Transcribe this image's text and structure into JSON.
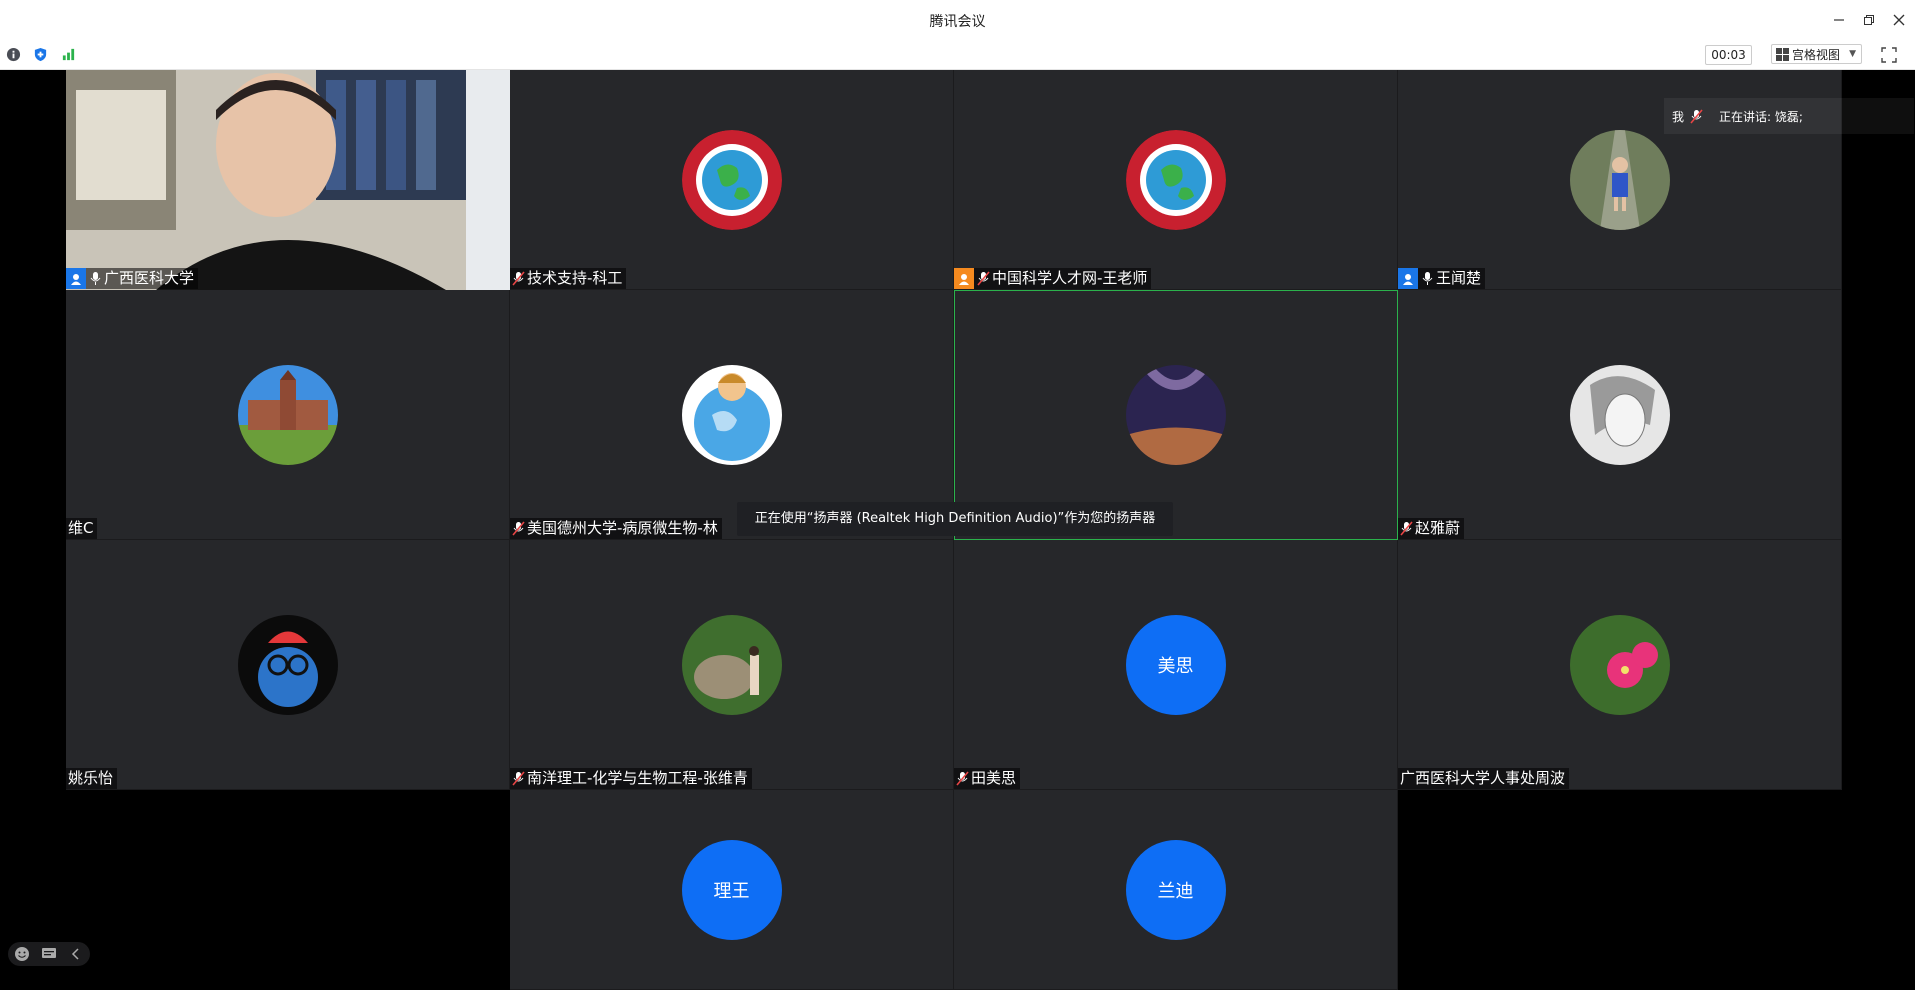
{
  "window": {
    "title": "腾讯会议"
  },
  "toolbar": {
    "icons": [
      "info-icon",
      "shield-icon",
      "signal-icon"
    ],
    "timer": "00:03",
    "view_label": "宫格视图"
  },
  "speaking_panel": {
    "me_label": "我",
    "speaking_label": "正在讲话: 饶磊;"
  },
  "toast": {
    "text": "正在使用“扬声器 (Realtek High Definition Audio)”作为您的扬声器"
  },
  "participants": [
    {
      "name": "广西医科大学",
      "role": "host",
      "mic": "on",
      "avatar": "video"
    },
    {
      "name": "技术支持-科工",
      "role": "none",
      "mic": "muted",
      "avatar": "logo"
    },
    {
      "name": "中国科学人才网-王老师",
      "role": "cohost",
      "mic": "muted",
      "avatar": "logo"
    },
    {
      "name": "王闻楚",
      "role": "host",
      "mic": "on",
      "avatar": "photo-child"
    },
    {
      "name": "维C",
      "role": "none",
      "mic": "none",
      "avatar": "photo-building"
    },
    {
      "name": "美国德州大学-病原微生物-林",
      "role": "none",
      "mic": "muted",
      "avatar": "cartoon-globe"
    },
    {
      "name": "",
      "role": "none",
      "mic": "none",
      "avatar": "photo-desert"
    },
    {
      "name": "赵雅蔚",
      "role": "none",
      "mic": "muted",
      "avatar": "sketch-face"
    },
    {
      "name": "姚乐怡",
      "role": "none",
      "mic": "none",
      "avatar": "toy-figure"
    },
    {
      "name": "南洋理工-化学与生物工程-张维青",
      "role": "none",
      "mic": "muted",
      "avatar": "photo-rock"
    },
    {
      "name": "田美思",
      "role": "none",
      "mic": "muted",
      "avatar": "text",
      "avatar_text": "美思"
    },
    {
      "name": "广西医科大学人事处周波",
      "role": "none",
      "mic": "none",
      "avatar": "photo-flower"
    },
    {
      "name": "",
      "role": "none",
      "mic": "none",
      "avatar": "text",
      "avatar_text": "理王"
    },
    {
      "name": "",
      "role": "none",
      "mic": "none",
      "avatar": "text",
      "avatar_text": "兰迪"
    }
  ],
  "colors": {
    "tile_bg": "#26272a",
    "avatar_blue": "#0e6ef5",
    "active_border": "#2bb24c",
    "host_badge": "#1a76e8",
    "cohost_badge": "#f58a1f"
  }
}
